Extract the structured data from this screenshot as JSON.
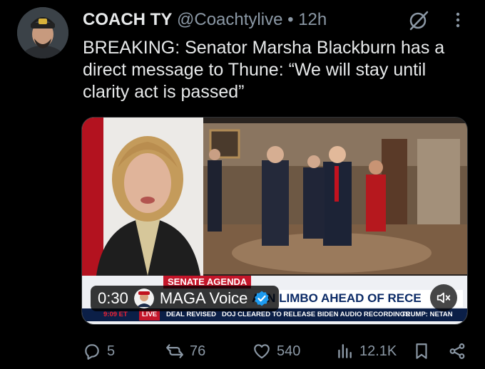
{
  "post": {
    "author_name": "COACH TY",
    "handle": "@Coachtylive",
    "separator": "•",
    "time": "12h",
    "text": "BREAKING: Senator Marsha Blackburn has a direct message to Thune: “We will stay until clarity act is passed”"
  },
  "video": {
    "duration": "0:30",
    "source_name": "MAGA Voice",
    "agenda_label": "SENATE AGENDA",
    "chyron_text": "A IN LIMBO AHEAD OF RECE",
    "ticker": {
      "clock": "9:09 ET",
      "live": "LIVE",
      "items": [
        "DEAL REVISED",
        "DOJ CLEARED TO RELEASE BIDEN AUDIO RECORDINGS",
        "TRUMP: NETAN"
      ]
    }
  },
  "actions": {
    "replies": "5",
    "reposts": "76",
    "likes": "540",
    "views": "12.1K"
  },
  "colors": {
    "accent_blue": "#1d9bf0",
    "muted": "#8b98a5",
    "text": "#e7e9ea"
  }
}
